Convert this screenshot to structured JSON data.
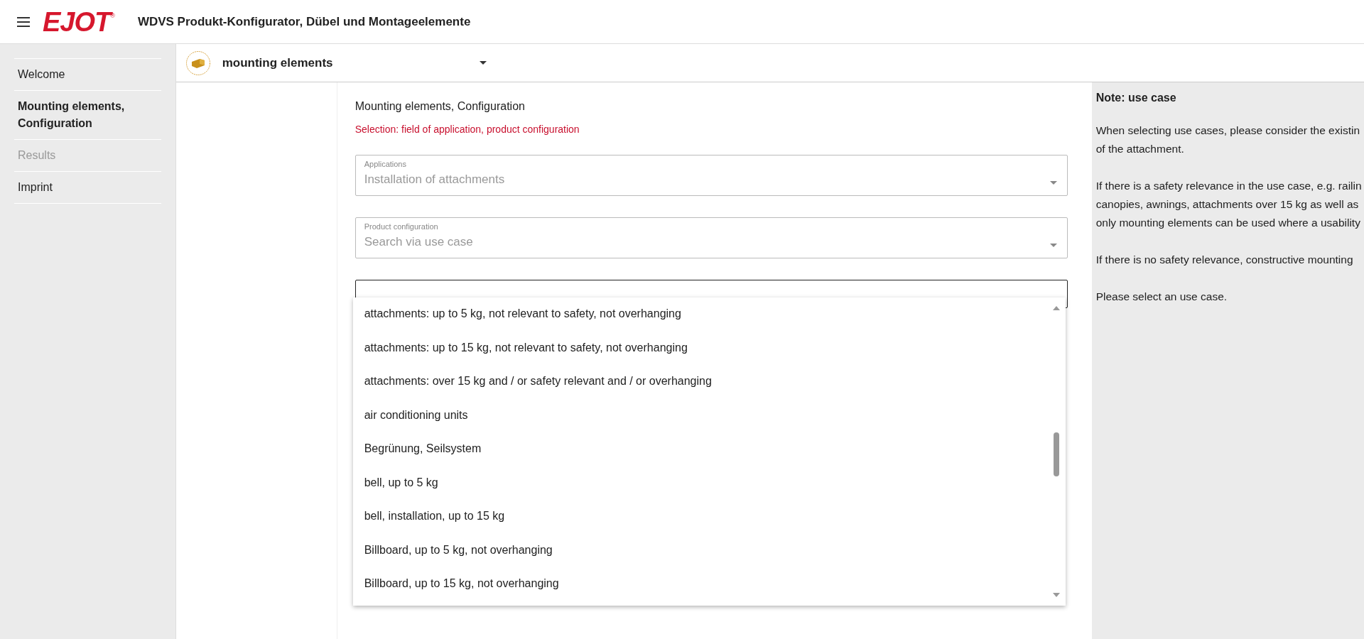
{
  "header": {
    "logo": "EJOT",
    "logo_mark": "®",
    "title": "WDVS Produkt-Konfigurator, Dübel und Montageelemente"
  },
  "sidebar": {
    "items": [
      {
        "label": "Welcome",
        "selected": false,
        "disabled": false
      },
      {
        "label": "Mounting elements, Configuration",
        "selected": true,
        "disabled": false
      },
      {
        "label": "Results",
        "selected": false,
        "disabled": true
      },
      {
        "label": "Imprint",
        "selected": false,
        "disabled": false
      }
    ]
  },
  "category_select": {
    "value": "mounting elements"
  },
  "form": {
    "heading": "Mounting elements, Configuration",
    "hint": "Selection: field of application, product configuration",
    "fields": [
      {
        "label": "Applications",
        "value": "Installation of attachments",
        "open": false
      },
      {
        "label": "Product configuration",
        "value": "Search via use case",
        "open": false
      },
      {
        "open": true
      }
    ],
    "options": [
      "attachments: up to 5 kg, not relevant to safety, not overhanging",
      "attachments: up to 15 kg, not relevant to safety, not overhanging",
      "attachments: over 15 kg and / or safety relevant and / or overhanging",
      "air conditioning units",
      "Begrünung, Seilsystem",
      "bell, up to 5 kg",
      "bell, installation, up to 15 kg",
      "Billboard, up to 5 kg, not overhanging",
      "Billboard, up to 15 kg, not overhanging"
    ]
  },
  "note": {
    "title": "Note: use case",
    "paragraphs": [
      [
        "When selecting use cases, please consider the existin",
        "of the attachment."
      ],
      [
        "If there is a safety relevance in the use case, e.g. railin",
        "canopies, awnings, attachments over 15 kg as well as",
        "only mounting elements can be used where a usability"
      ],
      [
        "If there is no safety relevance, constructive mounting"
      ],
      [
        "Please select an use case."
      ]
    ]
  }
}
